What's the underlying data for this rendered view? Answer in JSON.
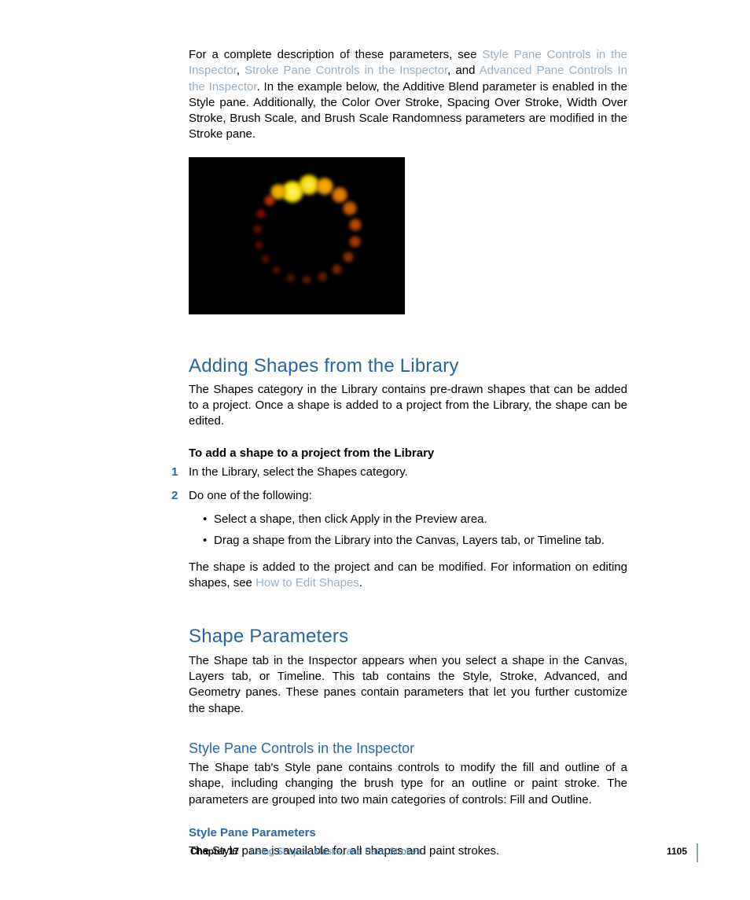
{
  "intro": {
    "t0": "For a complete description of these parameters, see ",
    "link1": "Style Pane Controls in the Inspector",
    "t1": ", ",
    "link2": "Stroke Pane Controls in the Inspector",
    "t2": ", and ",
    "link3": "Advanced Pane Controls In the Inspector",
    "t3": ". In the example below, the Additive Blend parameter is enabled in the Style pane. Additionally, the Color Over Stroke, Spacing Over Stroke, Width Over Stroke, Brush Scale, and Brush Scale Randomness parameters are modified in the Stroke pane."
  },
  "section1": {
    "heading": "Adding Shapes from the Library",
    "para": "The Shapes category in the Library contains pre-drawn shapes that can be added to a project. Once a shape is added to a project from the Library, the shape can be edited.",
    "task_title": "To add a shape to a project from the Library",
    "step1_num": "1",
    "step1": "In the Library, select the Shapes category.",
    "step2_num": "2",
    "step2": "Do one of the following:",
    "bullet1": "Select a shape, then click Apply in the Preview area.",
    "bullet2": "Drag a shape from the Library into the Canvas, Layers tab, or Timeline tab.",
    "closing_a": "The shape is added to the project and can be modified. For information on editing shapes, see ",
    "closing_link": "How to Edit Shapes",
    "closing_b": "."
  },
  "section2": {
    "heading": "Shape Parameters",
    "para": "The Shape tab in the Inspector appears when you select a shape in the Canvas, Layers tab, or Timeline. This tab contains the Style, Stroke, Advanced, and Geometry panes. These panes contain parameters that let you further customize the shape.",
    "sub_heading": "Style Pane Controls in the Inspector",
    "sub_para": "The Shape tab's Style pane contains controls to modify the fill and outline of a shape, including changing the brush type for an outline or paint stroke. The parameters are grouped into two main categories of controls: Fill and Outline.",
    "sub2_heading": "Style Pane Parameters",
    "sub2_para": "The Style pane is available for all shapes and paint strokes."
  },
  "footer": {
    "chapter": "Chapter 17",
    "title": "Using Shapes, Masks, and Paint Strokes",
    "page": "1105"
  }
}
